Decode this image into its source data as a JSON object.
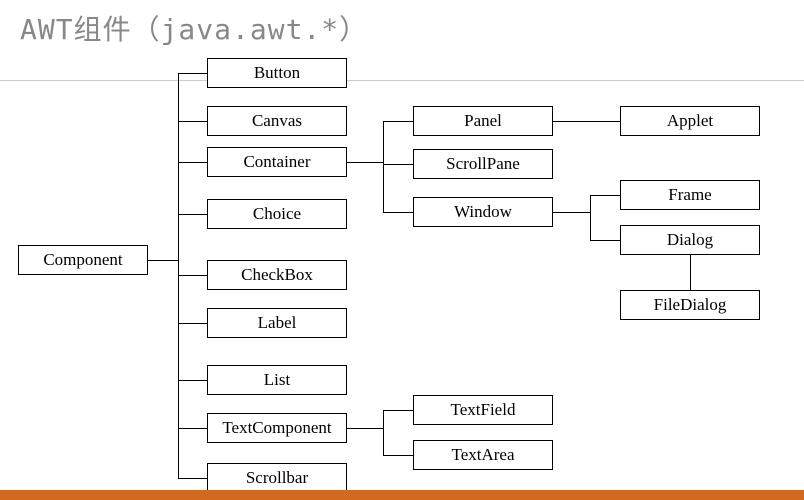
{
  "title": "AWT组件（java.awt.*）",
  "nodes": {
    "component": "Component",
    "button": "Button",
    "canvas": "Canvas",
    "container": "Container",
    "choice": "Choice",
    "checkbox": "CheckBox",
    "label": "Label",
    "list": "List",
    "textcomponent": "TextComponent",
    "scrollbar": "Scrollbar",
    "panel": "Panel",
    "scrollpane": "ScrollPane",
    "window": "Window",
    "applet": "Applet",
    "frame": "Frame",
    "dialog": "Dialog",
    "filedialog": "FileDialog",
    "textfield": "TextField",
    "textarea": "TextArea"
  }
}
